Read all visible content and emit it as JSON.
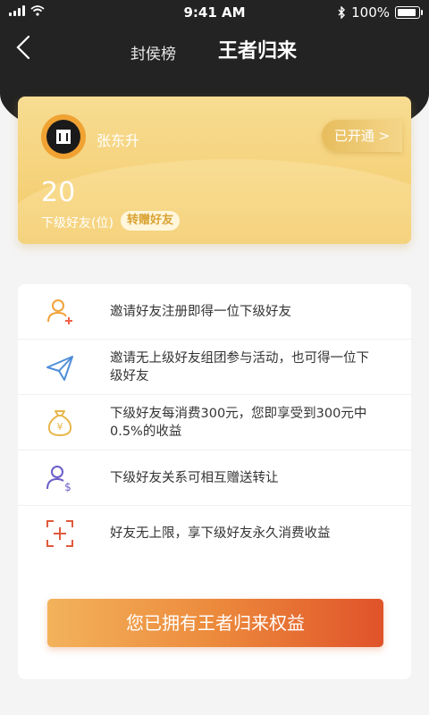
{
  "status_bar": {
    "time": "9:41 AM",
    "battery": "100%"
  },
  "nav": {
    "tab_rank": "封侯榜",
    "tab_current": "王者归来"
  },
  "vip_card": {
    "user_name": "张东升",
    "opened_label": "已开通 >",
    "subordinate_count": "20",
    "subordinate_label": "下级好友(位)",
    "gift_label": "转赠好友"
  },
  "benefits": [
    {
      "icon": "user-add-icon",
      "text": "邀请好友注册即得一位下级好友"
    },
    {
      "icon": "paper-plane-icon",
      "text": "邀请无上级好友组团参与活动，也可得一位下级好友"
    },
    {
      "icon": "money-bag-icon",
      "text": "下级好友每消费300元，您即享受到300元中0.5%的收益"
    },
    {
      "icon": "user-transfer-icon",
      "text": "下级好友关系可相互赠送转让"
    },
    {
      "icon": "unlimited-add-icon",
      "text": "好友无上限，享下级好友永久消费收益"
    }
  ],
  "action": {
    "rights_label": "您已拥有王者归来权益"
  },
  "colors": {
    "header_bg": "#232323",
    "card_gold": "#f5d27a",
    "accent_orange": "#ec8a3c",
    "accent_red": "#e0532a"
  }
}
